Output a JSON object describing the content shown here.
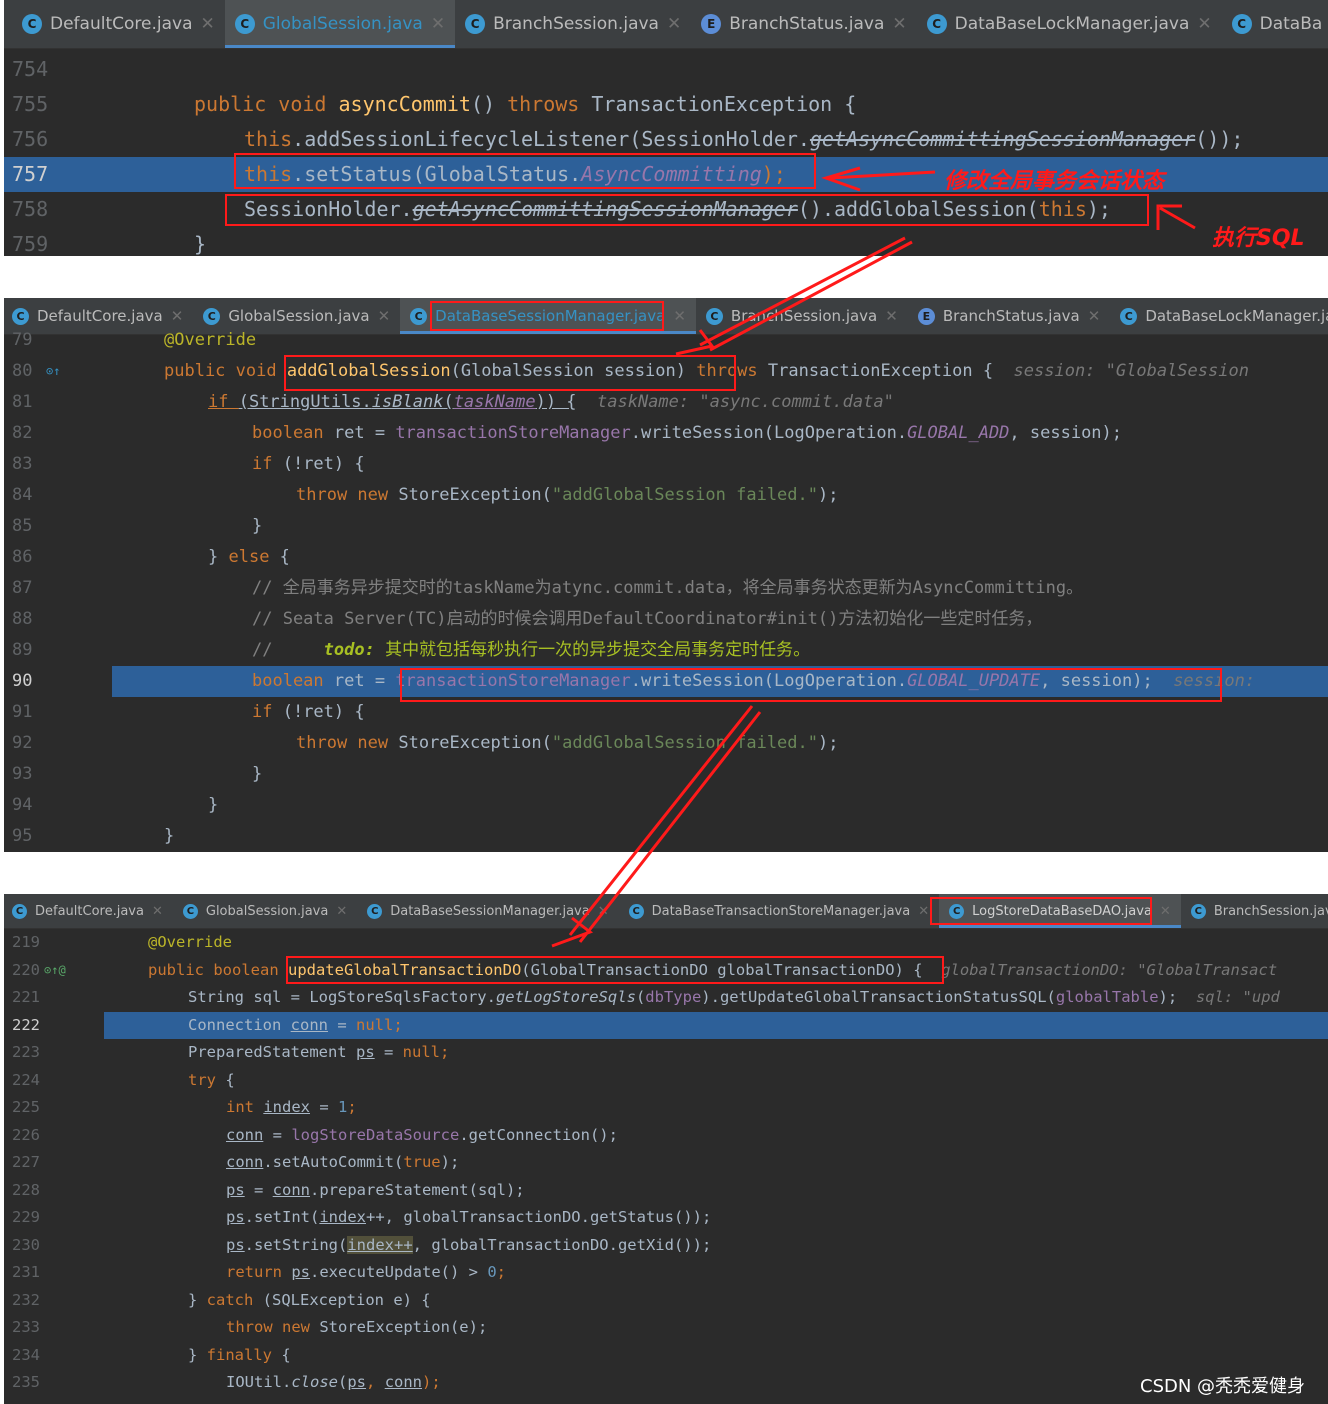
{
  "panel1": {
    "tabs": [
      {
        "icon": "C",
        "label": "DefaultCore.java",
        "active": false,
        "close": true
      },
      {
        "icon": "C",
        "label": "GlobalSession.java",
        "active": true,
        "close": true
      },
      {
        "icon": "C",
        "label": "BranchSession.java",
        "active": false,
        "close": true
      },
      {
        "icon": "E",
        "label": "BranchStatus.java",
        "active": false,
        "close": true
      },
      {
        "icon": "C",
        "label": "DataBaseLockManager.java",
        "active": false,
        "close": true
      },
      {
        "icon": "C",
        "label": "DataBa",
        "active": false,
        "close": false
      }
    ],
    "lines": [
      "754",
      "755",
      "756",
      "757",
      "758",
      "759"
    ],
    "highlight_line": "757",
    "code": {
      "l755": [
        "public void ",
        "asyncCommit",
        "() ",
        "throws ",
        "TransactionException {"
      ],
      "l756": [
        "this",
        ".addSessionLifecycleListener(SessionHolder.",
        "getAsyncCommittingSessionManager",
        "());"
      ],
      "l757": [
        "this",
        ".setStatus(GlobalStatus.",
        "AsyncCommitting",
        ");"
      ],
      "l758": [
        "SessionHolder.",
        "getAsyncCommittingSessionManager",
        "().addGlobalSession(",
        "this",
        ");"
      ],
      "l759": [
        "}"
      ]
    },
    "annotation1": "修改全局事务会话状态",
    "annotation2": "执行SQL"
  },
  "panel2": {
    "tabs": [
      {
        "icon": "C",
        "label": "DefaultCore.java",
        "active": false,
        "close": true
      },
      {
        "icon": "C",
        "label": "GlobalSession.java",
        "active": false,
        "close": true
      },
      {
        "icon": "C",
        "label": "DataBaseSessionManager.java",
        "active": true,
        "close": true
      },
      {
        "icon": "C",
        "label": "BranchSession.java",
        "active": false,
        "close": true
      },
      {
        "icon": "E",
        "label": "BranchStatus.java",
        "active": false,
        "close": true
      },
      {
        "icon": "C",
        "label": "DataBaseLockManager.java",
        "active": false,
        "close": false
      }
    ],
    "lines": [
      "79",
      "80",
      "81",
      "82",
      "83",
      "84",
      "85",
      "86",
      "87",
      "88",
      "89",
      "90",
      "91",
      "92",
      "93",
      "94",
      "95"
    ],
    "highlight_line": "90",
    "code": {
      "l79": "@Override",
      "l80": [
        "public void ",
        "addGlobalSession",
        "(GlobalSession session) ",
        "throws ",
        "TransactionException {",
        "  session: \"GlobalSession"
      ],
      "l81": [
        "if ",
        "(StringUtils.",
        "isBlank",
        "(",
        "taskName",
        ")) {",
        "  taskName: \"async.commit.data\""
      ],
      "l82": [
        "boolean ",
        "ret = ",
        "transactionStoreManager",
        ".writeSession(LogOperation.",
        "GLOBAL_ADD",
        ", session);"
      ],
      "l83": [
        "if ",
        "(!ret) {"
      ],
      "l84": [
        "throw new ",
        "StoreException(",
        "\"addGlobalSession failed.\"",
        ");"
      ],
      "l85": "}",
      "l86": [
        "} ",
        "else ",
        "{"
      ],
      "l87": "// 全局事务异步提交时的taskName为atync.commit.data，将全局事务状态更新为AsyncCommitting。",
      "l88": "// Seata Server(TC)启动的时候会调用DefaultCoordinator#init()方法初始化一些定时任务，",
      "l89": [
        "//     ",
        "todo: ",
        "其中就包括每秒执行一次的异步提交全局事务定时任务。"
      ],
      "l90": [
        "boolean ",
        "ret = ",
        "transactionStoreManager",
        ".writeSession(LogOperation.",
        "GLOBAL_UPDATE",
        ", session);",
        "  session:"
      ],
      "l91": [
        "if ",
        "(!ret) {"
      ],
      "l92": [
        "throw new ",
        "StoreException(",
        "\"addGlobalSession failed.\"",
        ");"
      ],
      "l93": "}",
      "l94": "}",
      "l95": "}"
    }
  },
  "panel3": {
    "tabs": [
      {
        "icon": "C",
        "label": "DefaultCore.java",
        "active": false,
        "close": true
      },
      {
        "icon": "C",
        "label": "GlobalSession.java",
        "active": false,
        "close": true
      },
      {
        "icon": "C",
        "label": "DataBaseSessionManager.java",
        "active": false,
        "close": true
      },
      {
        "icon": "C",
        "label": "DataBaseTransactionStoreManager.java",
        "active": false,
        "close": true
      },
      {
        "icon": "C",
        "label": "LogStoreDataBaseDAO.java",
        "active": true,
        "close": true
      },
      {
        "icon": "C",
        "label": "BranchSession.java",
        "active": false,
        "close": false
      }
    ],
    "lines": [
      "219",
      "220",
      "221",
      "222",
      "223",
      "224",
      "225",
      "226",
      "227",
      "228",
      "229",
      "230",
      "231",
      "232",
      "233",
      "234",
      "235"
    ],
    "highlight_line": "222",
    "code": {
      "l219": "@Override",
      "l220": [
        "public boolean ",
        "updateGlobalTransactionDO",
        "(GlobalTransactionDO globalTransactionDO) {",
        "  globalTransactionDO: \"GlobalTransact"
      ],
      "l221": [
        "String sql = LogStoreSqlsFactory.",
        "getLogStoreSqls",
        "(",
        "dbType",
        ").getUpdateGlobalTransactionStatusSQL(",
        "globalTable",
        ");",
        "  sql: \"upd"
      ],
      "l222": [
        "Connection ",
        "conn",
        " = ",
        "null",
        ";"
      ],
      "l223": [
        "PreparedStatement ",
        "ps",
        " = ",
        "null",
        ";"
      ],
      "l224": [
        "try ",
        "{"
      ],
      "l225": [
        "int ",
        "index",
        " = ",
        "1",
        ";"
      ],
      "l226": [
        "conn",
        " = ",
        "logStoreDataSource",
        ".getConnection();"
      ],
      "l227": [
        "conn",
        ".setAutoCommit(",
        "true",
        ");"
      ],
      "l228": [
        "ps",
        " = ",
        "conn",
        ".prepareStatement(sql);"
      ],
      "l229": [
        "ps",
        ".setInt(",
        "index",
        "++, globalTransactionDO.getStatus());"
      ],
      "l230": [
        "ps",
        ".setString(",
        "index++",
        ", globalTransactionDO.getXid());"
      ],
      "l231": [
        "return ",
        "ps",
        ".executeUpdate() > ",
        "0",
        ";"
      ],
      "l232": [
        "} ",
        "catch ",
        "(SQLException e) {"
      ],
      "l233": [
        "throw new ",
        "StoreException(e);"
      ],
      "l234": [
        "} ",
        "finally ",
        "{"
      ],
      "l235": [
        "IOUtil.",
        "close",
        "(",
        "ps",
        ", ",
        "conn",
        ");"
      ]
    },
    "watermark": "CSDN @秃秃爱健身"
  },
  "colors": {
    "accent": "#3592c4",
    "highlight": "#2d6099",
    "annotation": "#ff1a1a"
  }
}
